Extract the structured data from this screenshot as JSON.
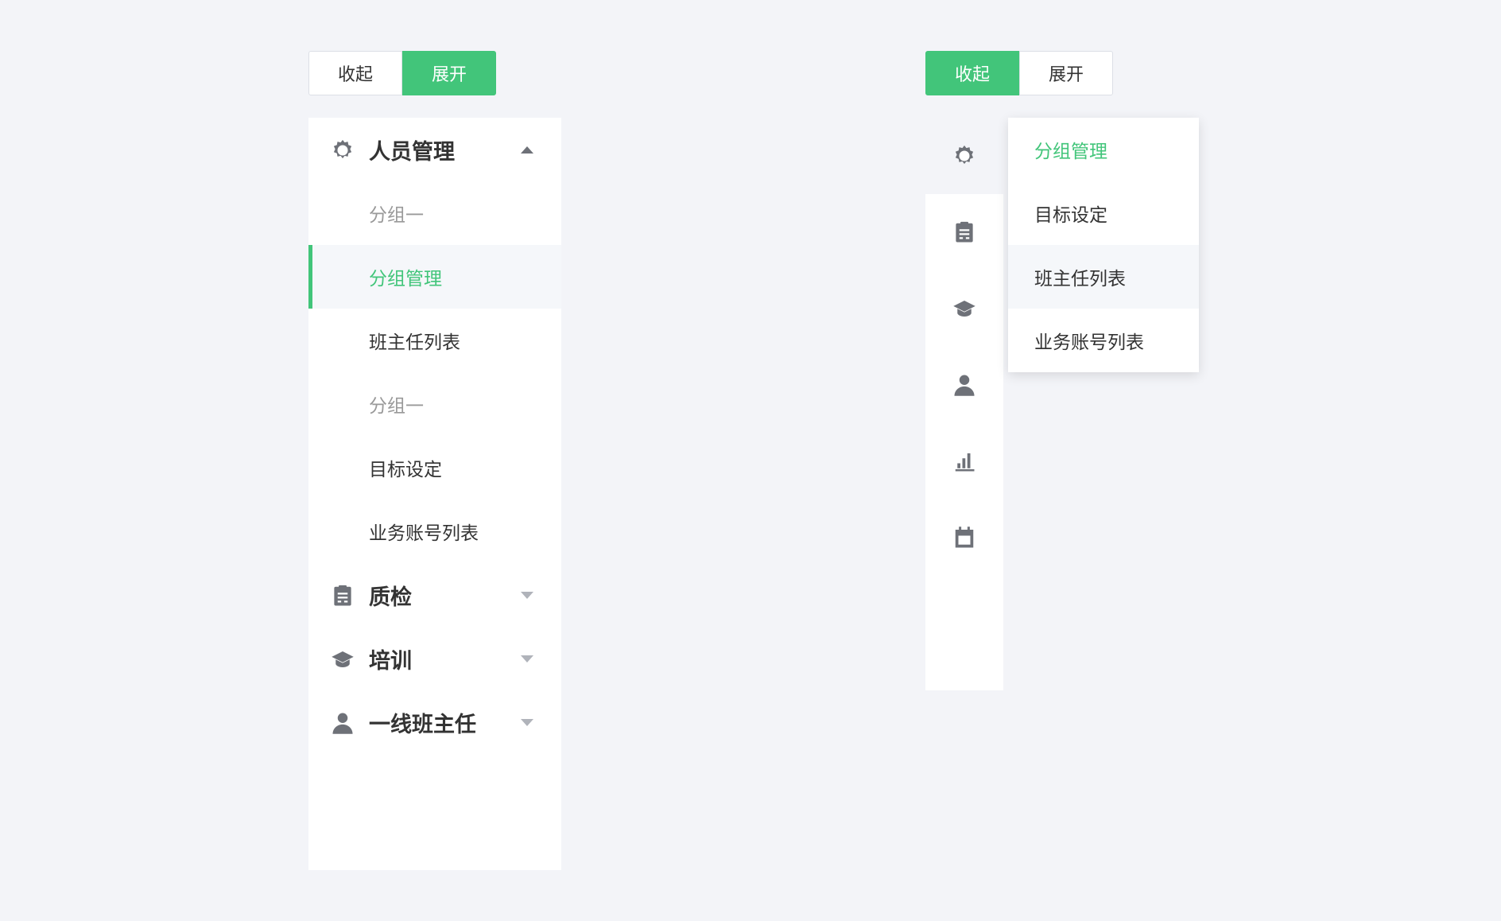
{
  "toggles": {
    "collapse_label": "收起",
    "expand_label": "展开"
  },
  "colors": {
    "accent": "#42c57a",
    "background": "#f3f4f8",
    "icon": "#6e7178",
    "active_row": "#f5f7fa"
  },
  "expanded_menu": {
    "groups": [
      {
        "label": "人员管理",
        "icon": "gear-icon",
        "state": "open",
        "sections": [
          {
            "title": "分组一",
            "items": [
              "分组管理",
              "班主任列表"
            ]
          },
          {
            "title": "分组一",
            "items": [
              "目标设定",
              "业务账号列表"
            ]
          }
        ]
      },
      {
        "label": "质检",
        "icon": "clipboard-icon",
        "state": "closed"
      },
      {
        "label": "培训",
        "icon": "graduation-cap-icon",
        "state": "closed"
      },
      {
        "label": "一线班主任",
        "icon": "user-icon",
        "state": "closed"
      }
    ],
    "active_item": "分组管理"
  },
  "collapsed_menu": {
    "icons": [
      "gear-icon",
      "clipboard-icon",
      "graduation-cap-icon",
      "user-icon",
      "bar-chart-icon",
      "calendar-icon"
    ],
    "active_index": 0
  },
  "popup": {
    "items": [
      "分组管理",
      "目标设定",
      "班主任列表",
      "业务账号列表"
    ],
    "active_item": "分组管理",
    "hovered_item": "班主任列表"
  }
}
